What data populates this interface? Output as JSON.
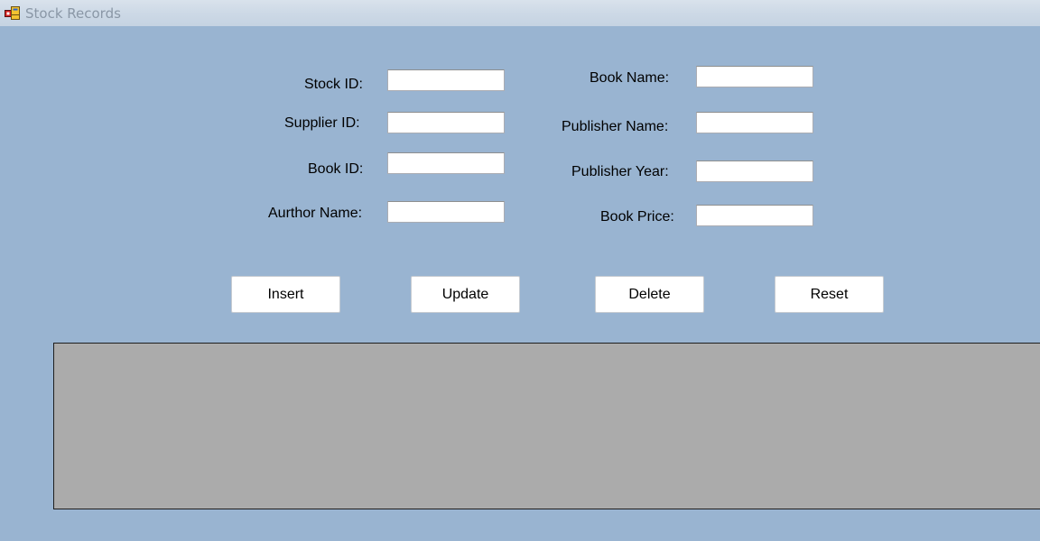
{
  "window": {
    "title": "Stock Records",
    "icon": "winforms-app-icon"
  },
  "form": {
    "left_fields": [
      {
        "label": "Stock ID:",
        "value": ""
      },
      {
        "label": "Supplier ID:",
        "value": ""
      },
      {
        "label": "Book ID:",
        "value": ""
      },
      {
        "label": "Aurthor Name:",
        "value": ""
      }
    ],
    "right_fields": [
      {
        "label": "Book Name:",
        "value": ""
      },
      {
        "label": "Publisher Name:",
        "value": ""
      },
      {
        "label": "Publisher Year:",
        "value": ""
      },
      {
        "label": "Book Price:",
        "value": ""
      }
    ]
  },
  "buttons": {
    "insert": "Insert",
    "update": "Update",
    "delete": "Delete",
    "reset": "Reset"
  },
  "colors": {
    "form_background": "#99b4d1",
    "grid_background": "#ababab"
  }
}
